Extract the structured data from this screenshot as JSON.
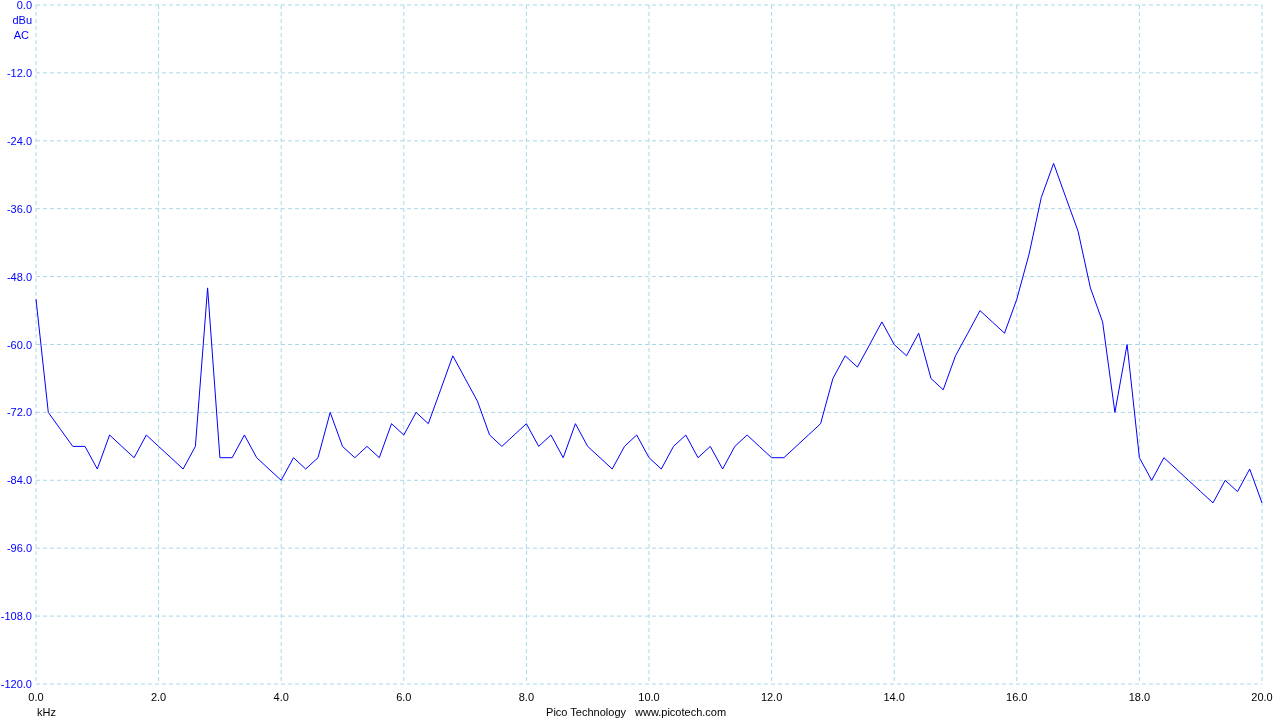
{
  "spectrum": {
    "coupling": "AC",
    "chart_data": {
      "type": "line",
      "grid": true,
      "xlabel": "kHz",
      "ylabel": "dBu",
      "xlim": [
        0,
        20
      ],
      "ylim": [
        -120,
        0
      ],
      "xticks": [
        {
          "value": 0,
          "label": "0.0"
        },
        {
          "value": 2,
          "label": "2.0"
        },
        {
          "value": 4,
          "label": "4.0"
        },
        {
          "value": 6,
          "label": "6.0"
        },
        {
          "value": 8,
          "label": "8.0"
        },
        {
          "value": 10,
          "label": "10.0"
        },
        {
          "value": 12,
          "label": "12.0"
        },
        {
          "value": 14,
          "label": "14.0"
        },
        {
          "value": 16,
          "label": "16.0"
        },
        {
          "value": 18,
          "label": "18.0"
        },
        {
          "value": 20,
          "label": "20.0"
        }
      ],
      "yticks": [
        {
          "value": 0,
          "label": "0.0"
        },
        {
          "value": -12,
          "label": "-12.0"
        },
        {
          "value": -24,
          "label": "-24.0"
        },
        {
          "value": -36,
          "label": "-36.0"
        },
        {
          "value": -48,
          "label": "-48.0"
        },
        {
          "value": -60,
          "label": "-60.0"
        },
        {
          "value": -72,
          "label": "-72.0"
        },
        {
          "value": -84,
          "label": "-84.0"
        },
        {
          "value": -96,
          "label": "-96.0"
        },
        {
          "value": -108,
          "label": "-108.0"
        },
        {
          "value": -120,
          "label": "-120.0"
        }
      ],
      "x": [
        0,
        0.2,
        0.4,
        0.6,
        0.8,
        1,
        1.2,
        1.4,
        1.6,
        1.8,
        2,
        2.2,
        2.4,
        2.6,
        2.8,
        3,
        3.2,
        3.4,
        3.6,
        3.8,
        4,
        4.2,
        4.4,
        4.6,
        4.8,
        5,
        5.2,
        5.4,
        5.6,
        5.8,
        6,
        6.2,
        6.4,
        6.6,
        6.8,
        7,
        7.2,
        7.4,
        7.6,
        7.8,
        8,
        8.2,
        8.4,
        8.6,
        8.8,
        9,
        9.2,
        9.4,
        9.6,
        9.8,
        10,
        10.2,
        10.4,
        10.6,
        10.8,
        11,
        11.2,
        11.4,
        11.6,
        11.8,
        12,
        12.2,
        12.4,
        12.6,
        12.8,
        13,
        13.2,
        13.4,
        13.6,
        13.8,
        14,
        14.2,
        14.4,
        14.6,
        14.8,
        15,
        15.2,
        15.4,
        15.6,
        15.8,
        16,
        16.2,
        16.4,
        16.6,
        16.8,
        17,
        17.2,
        17.4,
        17.6,
        17.8,
        18,
        18.2,
        18.4,
        18.6,
        18.8,
        19,
        19.2,
        19.4,
        19.6,
        19.8,
        20
      ],
      "series": [
        {
          "color": "#0000ff",
          "values": [
            -52,
            -72,
            -75,
            -78,
            -78,
            -82,
            -76,
            -78,
            -80,
            -76,
            -78,
            -80,
            -82,
            -78,
            -50,
            -80,
            -80,
            -76,
            -80,
            -82,
            -84,
            -80,
            -82,
            -80,
            -72,
            -78,
            -80,
            -78,
            -80,
            -74,
            -76,
            -72,
            -74,
            -68,
            -62,
            -66,
            -70,
            -76,
            -78,
            -76,
            -74,
            -78,
            -76,
            -80,
            -74,
            -78,
            -80,
            -82,
            -78,
            -76,
            -80,
            -82,
            -78,
            -76,
            -80,
            -78,
            -82,
            -78,
            -76,
            -78,
            -80,
            -80,
            -78,
            -76,
            -74,
            -66,
            -62,
            -64,
            -60,
            -56,
            -60,
            -62,
            -58,
            -66,
            -68,
            -62,
            -58,
            -54,
            -56,
            -58,
            -52,
            -44,
            -34,
            -28,
            -34,
            -40,
            -50,
            -56,
            -72,
            -60,
            -80,
            -84,
            -80,
            -82,
            -84,
            -86,
            -88,
            -84,
            -86,
            -82,
            -88
          ]
        }
      ]
    }
  },
  "footer": {
    "company": "Pico Technology",
    "website": "www.picotech.com"
  }
}
